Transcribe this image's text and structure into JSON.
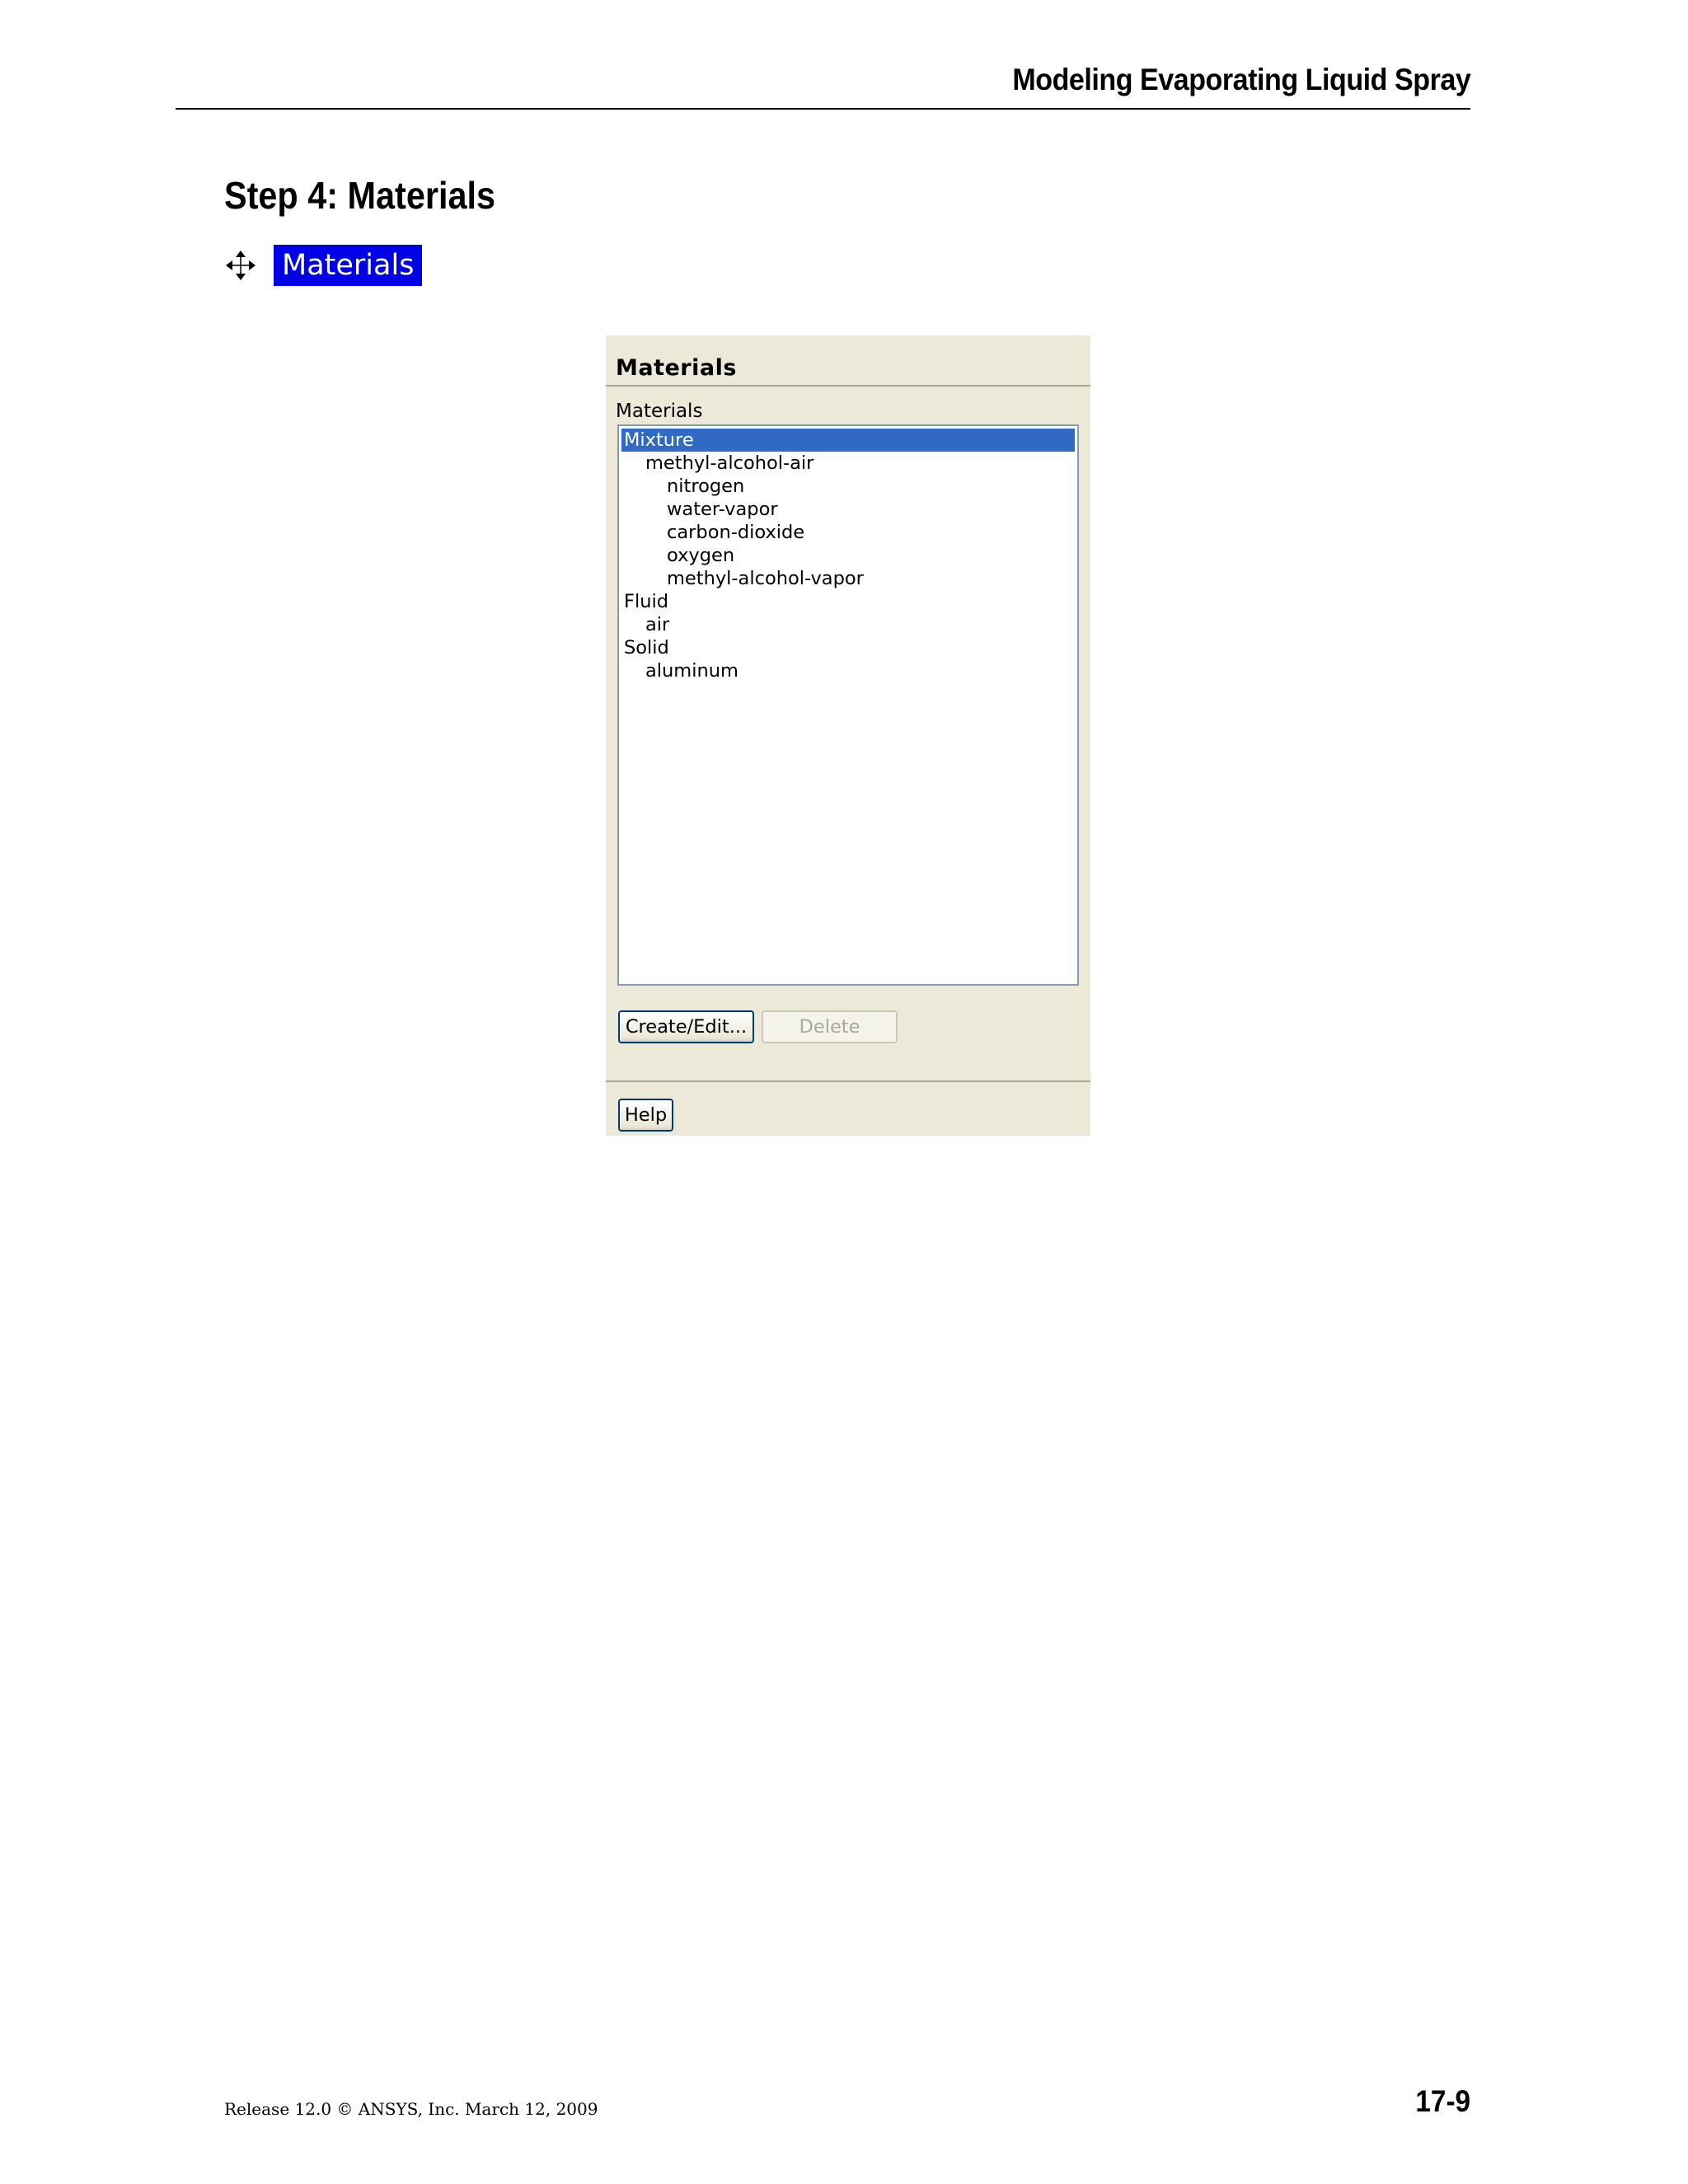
{
  "header": {
    "running_title": "Modeling Evaporating Liquid Spray"
  },
  "section": {
    "heading": "Step 4: Materials",
    "nav_link_label": "Materials",
    "nav_icon": "navigation-arrows-icon"
  },
  "panel": {
    "title": "Materials",
    "list_label": "Materials",
    "items": [
      {
        "label": "Mixture",
        "level": 0,
        "selected": true
      },
      {
        "label": "methyl-alcohol-air",
        "level": 1,
        "selected": false
      },
      {
        "label": "nitrogen",
        "level": 2,
        "selected": false
      },
      {
        "label": "water-vapor",
        "level": 2,
        "selected": false
      },
      {
        "label": "carbon-dioxide",
        "level": 2,
        "selected": false
      },
      {
        "label": "oxygen",
        "level": 2,
        "selected": false
      },
      {
        "label": "methyl-alcohol-vapor",
        "level": 2,
        "selected": false
      },
      {
        "label": "Fluid",
        "level": 0,
        "selected": false
      },
      {
        "label": "air",
        "level": 1,
        "selected": false
      },
      {
        "label": "Solid",
        "level": 0,
        "selected": false
      },
      {
        "label": "aluminum",
        "level": 1,
        "selected": false
      }
    ],
    "create_edit_label": "Create/Edit...",
    "delete_label": "Delete",
    "help_label": "Help"
  },
  "footer": {
    "release_text": "Release 12.0 © ANSYS, Inc. March 12, 2009",
    "page_number": "17-9"
  },
  "colors": {
    "nav_link_bg": "#0000e6",
    "selection": "#316ac5",
    "panel_bg": "#ece9d8"
  }
}
